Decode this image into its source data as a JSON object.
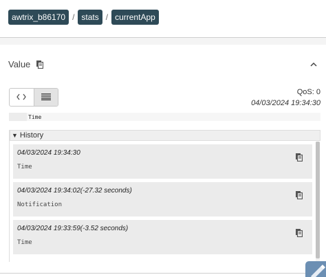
{
  "breadcrumb": {
    "items": [
      "awtrix_b86170",
      "stats",
      "currentApp"
    ],
    "separator": "/"
  },
  "value_section": {
    "title": "Value",
    "icons": {
      "copy": "copy-icon",
      "collapse": "chevron-up-icon"
    }
  },
  "view_toggle": {
    "code_view": "code-icon",
    "raw_view": "menu-lines-icon",
    "active": "raw_view"
  },
  "meta": {
    "qos": "QoS: 0",
    "timestamp": "04/03/2024 19:34:30"
  },
  "current_value": "Time",
  "history": {
    "label": "History",
    "expand_glyph": "▼",
    "items": [
      {
        "timestamp": "04/03/2024 19:34:30",
        "message": "Time"
      },
      {
        "timestamp": "04/03/2024 19:34:02(-27.32 seconds)",
        "message": "Notification"
      },
      {
        "timestamp": "04/03/2024 19:33:59(-3.52 seconds)",
        "message": "Time"
      }
    ]
  },
  "colors": {
    "chip_bg": "#2e4a57",
    "fab_bg": "#6c8fb3",
    "history_item_bg": "#ebebeb"
  }
}
